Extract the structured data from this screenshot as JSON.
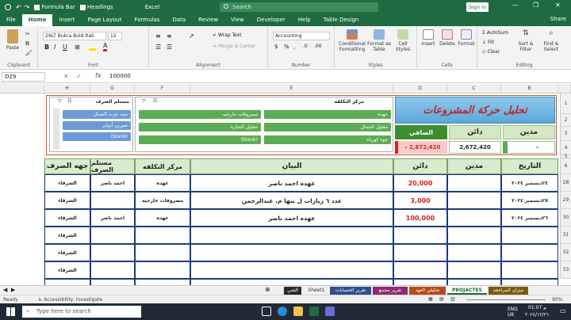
{
  "titlebar": {
    "formula_bar_label": "Formula Bar",
    "headings_label": "Headings",
    "app_name": "Excel",
    "search_placeholder": "Search",
    "signin": "Sign in"
  },
  "menu": [
    "File",
    "Home",
    "Insert",
    "Page Layout",
    "Formulas",
    "Data",
    "Review",
    "View",
    "Developer",
    "Help",
    "Table Design"
  ],
  "menu_active": "Home",
  "share_label": "Share",
  "ribbon": {
    "clipboard": {
      "paste": "Paste",
      "label": "Clipboard"
    },
    "font": {
      "name": "29LT Bukra Bold Itali",
      "size": "12",
      "label": "Font"
    },
    "alignment": {
      "wrap": "Wrap Text",
      "merge": "Merge & Center",
      "label": "Alignment"
    },
    "number": {
      "format": "Accounting",
      "label": "Number"
    },
    "styles": {
      "conditional": "Conditional Formatting",
      "format_table": "Format as Table",
      "cell_styles": "Cell Styles",
      "label": "Styles"
    },
    "cells": {
      "insert": "Insert",
      "delete": "Delete",
      "format": "Format",
      "label": "Cells"
    },
    "editing": {
      "autosum": "AutoSum",
      "fill": "Fill",
      "clear": "Clear",
      "sort": "Sort & Filter",
      "find": "Find & Select",
      "label": "Editing"
    }
  },
  "formula_bar": {
    "name_box": "D29",
    "fx": "fx",
    "value": "100000"
  },
  "columns": [
    "H",
    "G",
    "F",
    "E",
    "D",
    "C",
    "B"
  ],
  "rows": [
    "1",
    "2",
    "3",
    "4",
    "5",
    "6",
    "7",
    "28",
    "29",
    "30",
    "31",
    "32",
    "33"
  ],
  "slicers": {
    "expense": {
      "title": "مستلم الصرف",
      "items": [
        "سيد عزت الجمال",
        "شيرين آدولي",
        "(blank)"
      ]
    },
    "cost_center": {
      "title": "مركز التكلفه",
      "items": [
        "عهده",
        "مصروفات خارجيه",
        "مقاول الجمال",
        "مقاول التجاره",
        "جوء كهرباء",
        "(blank)"
      ]
    }
  },
  "summary": {
    "title": "تحليل حركة المشروعات",
    "labels": {
      "debit": "مدين",
      "credit": "دائن",
      "net": "الصافي"
    },
    "credit_value": "2,672,420",
    "net_value": "- 2,672,420",
    "debit_value": "-"
  },
  "table": {
    "headers": [
      "جهه الصرف",
      "مستلم الصرف",
      "مركز التكلفه",
      "البيان",
      "دائن",
      "مدين",
      "التاريخ"
    ],
    "rows": [
      [
        "الشرقاء",
        "احمد ناصر",
        "عهده",
        "عهده احمد ناصر",
        "20,000",
        "",
        "٢٤ديسمبر ٢٠٢٤"
      ],
      [
        "الشرقاء",
        "",
        "مصروفات خارجيه",
        "عدد ٦ زيارات ل بنها م. عبدالرحمن",
        "3,000",
        "",
        "٢٥ديسمبر ٢٠٢٤"
      ],
      [
        "الشرقاء",
        "احمد ناصر",
        "عهده",
        "عهده احمد ناصر",
        "100,000",
        "",
        "٢٦ديسمبر ٢٠٢٤"
      ],
      [
        "الشرقاء",
        "",
        "",
        "",
        "",
        "",
        ""
      ],
      [
        "الشرقاء",
        "",
        "",
        "",
        "",
        "",
        ""
      ],
      [
        "الشرقاء",
        "",
        "",
        "",
        "",
        "",
        ""
      ],
      [
        "الشرقاء",
        "",
        "",
        "",
        "",
        "",
        ""
      ]
    ]
  },
  "sheet_tabs": [
    "الشي",
    "Sheet1",
    "تقرير الحسابات",
    "تقرير مجمع",
    "تحليلي العهد",
    "PROJACTES",
    "ميزان المراجعه"
  ],
  "status": {
    "ready": "Ready",
    "accessibility": "Accessibility: Investigate",
    "zoom": "90%"
  },
  "taskbar": {
    "search": "Type here to search",
    "lang": "ENG UK",
    "time": "01:07 م",
    "date": "٢٠٢٤/١٢/٢٦"
  },
  "colors": {
    "excel_green": "#1e6b3f",
    "header_fill": "#d7ebcd",
    "slicer_green": "#5cac54",
    "slicer_blue": "#6e99d6",
    "red": "#d81e1e"
  }
}
